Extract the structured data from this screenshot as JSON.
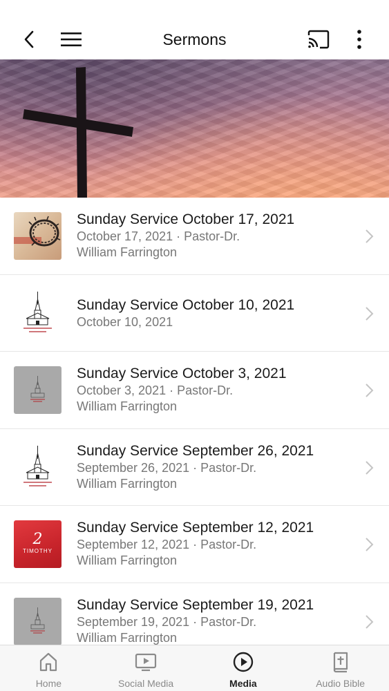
{
  "header": {
    "title": "Sermons"
  },
  "sermons": [
    {
      "title": "Sunday Service October 17, 2021",
      "line1": "October 17, 2021 · Pastor-Dr.",
      "line2": "William Farrington",
      "thumb": "crown-of-thorns"
    },
    {
      "title": "Sunday Service October 10, 2021",
      "line1": "October 10, 2021",
      "line2": "",
      "thumb": "church-logo"
    },
    {
      "title": "Sunday Service October 3, 2021",
      "line1": "October 3, 2021 · Pastor-Dr.",
      "line2": "William Farrington",
      "thumb": "church-logo-gray"
    },
    {
      "title": "Sunday Service September 26, 2021",
      "line1": "September 26, 2021 · Pastor-Dr.",
      "line2": "William Farrington",
      "thumb": "church-logo"
    },
    {
      "title": "Sunday Service September 12, 2021",
      "line1": "September 12, 2021 · Pastor-Dr.",
      "line2": "William Farrington",
      "thumb": "timothy"
    },
    {
      "title": "Sunday Service September 19, 2021",
      "line1": "September 19, 2021 · Pastor-Dr.",
      "line2": "William Farrington",
      "thumb": "church-logo-gray"
    }
  ],
  "thumb_text": {
    "timothy_number": "2",
    "timothy_word": "TIMOTHY"
  },
  "tabs": [
    {
      "label": "Home",
      "icon": "home-icon",
      "active": false
    },
    {
      "label": "Social Media",
      "icon": "tv-icon",
      "active": false
    },
    {
      "label": "Media",
      "icon": "play-circle-icon",
      "active": true
    },
    {
      "label": "Audio Bible",
      "icon": "bible-icon",
      "active": false
    }
  ]
}
